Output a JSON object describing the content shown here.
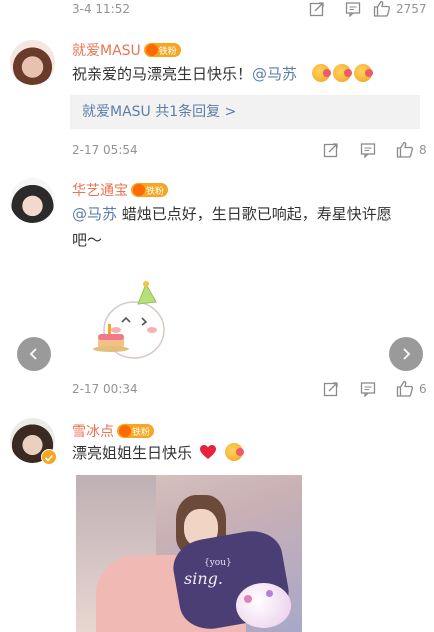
{
  "top_meta": {
    "time": "3-4 11:52",
    "like_count": "2757"
  },
  "comments": [
    {
      "username": "就爱MASU",
      "badge_text": "铁粉",
      "text_prefix": "祝亲爱的马漂亮生日快乐！",
      "mention": "@马苏",
      "reply_summary": "就爱MASU 共1条回复 >",
      "time": "2-17 05:54",
      "like_count": "8"
    },
    {
      "username": "华艺通宝",
      "badge_text": "铁粉",
      "mention": "@马苏",
      "text_line1": " 蜡烛已点好，生日歌已响起，寿星快许愿",
      "text_line2": "吧～",
      "time": "2-17 00:34",
      "like_count": "6"
    },
    {
      "username": "雪冰点",
      "badge_text": "铁粉",
      "text": "漂亮姐姐生日快乐",
      "image_text": "sing.",
      "image_small_text": "{you}"
    }
  ],
  "icons": [
    "share-icon",
    "comment-icon",
    "like-icon",
    "left-arrow-icon",
    "right-arrow-icon",
    "heart-emoji-icon"
  ]
}
